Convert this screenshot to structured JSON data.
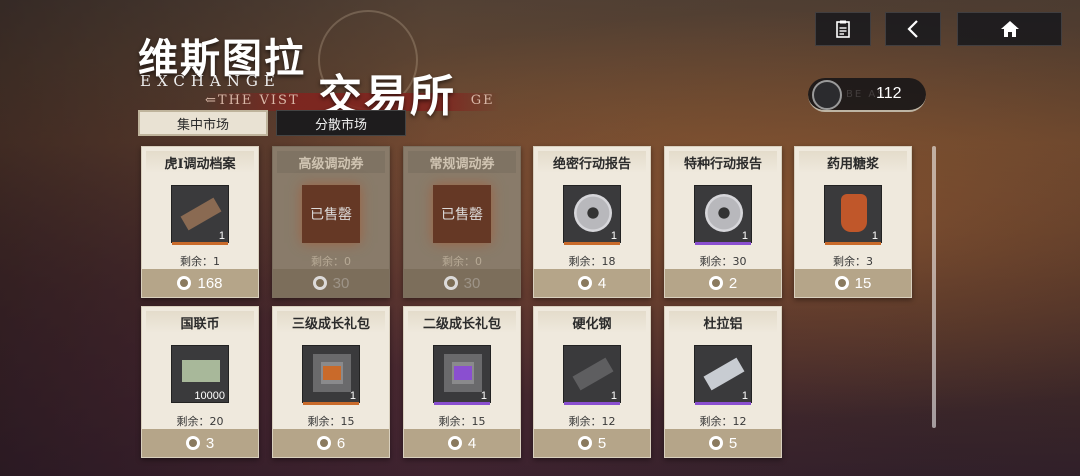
{
  "header": {
    "title_zh_part1": "维斯图拉",
    "title_zh_part2": "交易所",
    "title_en": "EXCHANGE",
    "subtitle": "⇐THE VIST",
    "subtitle_tail": "GE"
  },
  "top_buttons": {
    "list_icon": "clipboard-icon",
    "back_icon": "chevron-left-icon",
    "home_icon": "home-icon"
  },
  "currency": {
    "value": "112",
    "faint_label": "BE    AS"
  },
  "tabs": [
    {
      "label": "集中市场",
      "active": true
    },
    {
      "label": "分散市场",
      "active": false
    }
  ],
  "remain_prefix": "剩余：",
  "sold_label": "已售罄",
  "cards": [
    {
      "name": "虎Ⅰ调动档案",
      "qty": "1",
      "remain": "1",
      "price": "168",
      "sold": false,
      "bar": "#c96a2a",
      "icon": "document-icon"
    },
    {
      "name": "高级调动券",
      "qty": "",
      "remain": "0",
      "price": "30",
      "sold": true,
      "bar": "",
      "icon": ""
    },
    {
      "name": "常规调动券",
      "qty": "",
      "remain": "0",
      "price": "30",
      "sold": true,
      "bar": "",
      "icon": ""
    },
    {
      "name": "绝密行动报告",
      "qty": "1",
      "remain": "18",
      "price": "4",
      "sold": false,
      "bar": "#c96a2a",
      "icon": "disc-icon"
    },
    {
      "name": "特种行动报告",
      "qty": "1",
      "remain": "30",
      "price": "2",
      "sold": false,
      "bar": "#8a4fd0",
      "icon": "disc-icon"
    },
    {
      "name": "药用糖浆",
      "qty": "1",
      "remain": "3",
      "price": "15",
      "sold": false,
      "bar": "#c96a2a",
      "icon": "bottle-icon"
    },
    {
      "name": "国联币",
      "qty": "10000",
      "remain": "20",
      "price": "3",
      "sold": false,
      "bar": "",
      "icon": "banknote-icon"
    },
    {
      "name": "三级成长礼包",
      "qty": "1",
      "remain": "15",
      "price": "6",
      "sold": false,
      "bar": "#c96a2a",
      "icon": "crate-icon"
    },
    {
      "name": "二级成长礼包",
      "qty": "1",
      "remain": "15",
      "price": "4",
      "sold": false,
      "bar": "#8a4fd0",
      "icon": "crate-icon"
    },
    {
      "name": "硬化钢",
      "qty": "1",
      "remain": "12",
      "price": "5",
      "sold": false,
      "bar": "#8a4fd0",
      "icon": "steel-bar-icon"
    },
    {
      "name": "杜拉铝",
      "qty": "1",
      "remain": "12",
      "price": "5",
      "sold": false,
      "bar": "#8a4fd0",
      "icon": "aluminum-pipe-icon"
    }
  ]
}
